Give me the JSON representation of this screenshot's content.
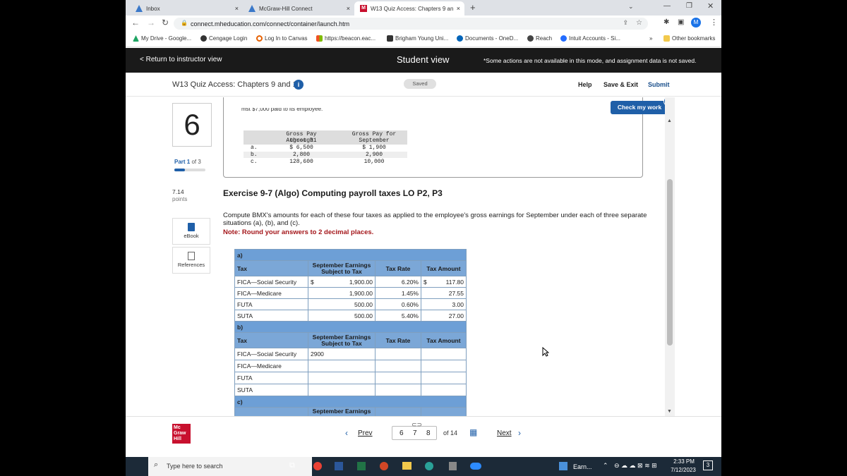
{
  "browser": {
    "tabs": [
      {
        "label": "Inbox",
        "close": "×"
      },
      {
        "label": "McGraw-Hill Connect",
        "close": "×"
      },
      {
        "label": "W13 Quiz Access: Chapters 9 an",
        "close": "×"
      }
    ],
    "new_tab": "+",
    "url": "connect.mheducation.com/connect/container/launch.htm",
    "bookmarks": [
      "My Drive - Google...",
      "Cengage Login",
      "Log In to Canvas",
      "https://beacon.eac...",
      "Brigham Young Uni...",
      "Documents - OneD...",
      "Reach",
      "Intuit Accounts - Si..."
    ],
    "bookmarks_more": "»",
    "other_bookmarks": "Other bookmarks",
    "profile_initial": "M"
  },
  "topnav": {
    "return_link": "< Return to instructor view",
    "title": "Student view",
    "notice": "*Some actions are not available in this mode, and assignment data is not saved."
  },
  "titlebar": {
    "quiz_title": "W13 Quiz Access: Chapters 9 and 10",
    "saved": "Saved",
    "help": "Help",
    "save_exit": "Save & Exit",
    "submit": "Submit"
  },
  "check_work": {
    "label": "Check my work",
    "count": "3"
  },
  "question": {
    "number": "6",
    "part_prefix": "Part ",
    "part_num": "1",
    "part_suffix": " of 3",
    "part_progress": 0.33,
    "points_value": "7.14",
    "points_label": "points",
    "ebook": "eBook",
    "references": "References"
  },
  "pay_table": {
    "clipped_text": "mst $7,000 paid to its employee.",
    "col1_head": [
      "Gross Pay through",
      "August 31"
    ],
    "col2_head": [
      "Gross Pay for",
      "September"
    ],
    "rows": [
      {
        "label": "a.",
        "aug": "$ 6,500",
        "sep": "$ 1,900"
      },
      {
        "label": "b.",
        "aug": "2,800",
        "sep": "2,900"
      },
      {
        "label": "c.",
        "aug": "128,600",
        "sep": "10,000"
      }
    ]
  },
  "exercise": {
    "title": "Exercise 9-7 (Algo) Computing payroll taxes LO P2, P3",
    "instructions": "Compute BMX's amounts for each of these four taxes as applied to the employee's gross earnings for September under each of three separate situations (a), (b), and (c).",
    "note": "Note: Round your answers to 2 decimal places."
  },
  "tax_table": {
    "col_tax": "Tax",
    "col_earn": "September Earnings Subject to Tax",
    "col_rate": "Tax Rate",
    "col_amount": "Tax Amount",
    "section_a": "a)",
    "section_b": "b)",
    "section_c": "c)",
    "a_rows": [
      {
        "tax": "FICA—Social Security",
        "cur": "$",
        "earn": "1,900.00",
        "rate": "6.20%",
        "cur2": "$",
        "amount": "117.80"
      },
      {
        "tax": "FICA—Medicare",
        "cur": "",
        "earn": "1,900.00",
        "rate": "1.45%",
        "cur2": "",
        "amount": "27.55"
      },
      {
        "tax": "FUTA",
        "cur": "",
        "earn": "500.00",
        "rate": "0.60%",
        "cur2": "",
        "amount": "3.00"
      },
      {
        "tax": "SUTA",
        "cur": "",
        "earn": "500.00",
        "rate": "5.40%",
        "cur2": "",
        "amount": "27.00"
      }
    ],
    "b_rows": [
      {
        "tax": "FICA—Social Security",
        "earn": "2900"
      },
      {
        "tax": "FICA—Medicare",
        "earn": ""
      },
      {
        "tax": "FUTA",
        "earn": ""
      },
      {
        "tax": "SUTA",
        "earn": ""
      }
    ],
    "c_partial_head": "September Earnings"
  },
  "pager": {
    "prev": "Prev",
    "pages": [
      "6",
      "7",
      "8"
    ],
    "of": "of 14",
    "next": "Next",
    "logo": [
      "Mc",
      "Graw",
      "Hill"
    ]
  },
  "taskbar": {
    "search_placeholder": "Type here to search",
    "app_label": "Earn...",
    "time": "2:33 PM",
    "date": "7/12/2023",
    "notif": "3"
  }
}
